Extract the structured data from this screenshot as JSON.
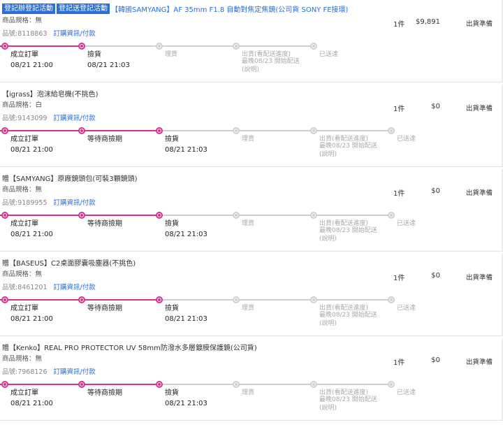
{
  "colors": {
    "accent": "#d9308c",
    "inactive": "#cfcfcf",
    "link": "#2a6fd6"
  },
  "orders": [
    {
      "badges": [
        "登記辦登記活動",
        "登記送登記活動"
      ],
      "name": "【韓國SAMYANG】AF 35mm F1.8 自動對焦定焦鏡(公司貨 SONY FE接環)",
      "name_color": "blue",
      "spec": "商品規格：無",
      "sku": "品號:8118863",
      "link": "訂購資訊/付款",
      "qty": "1件",
      "price": "$9,891",
      "status": "出貨準備",
      "steps": [
        {
          "label": "成立訂單",
          "time": "08/21 21:00",
          "active": true
        },
        {
          "label": "撿貨",
          "time": "08/21 21:03",
          "active": true
        },
        {
          "label": "理貨",
          "active": false
        },
        {
          "label": "出貨(看配送進度)",
          "note": "最晚08/23 開始配送\n(說明)",
          "active": false
        },
        {
          "label": "已送達",
          "active": false
        }
      ]
    },
    {
      "badges": [],
      "name": "【igrass】泡沫給皂機(不挑色)",
      "name_color": "dark",
      "spec": "商品規格：白",
      "sku": "品號:9143099",
      "link": "訂購資訊/付款",
      "qty": "1件",
      "price": "$0",
      "status": "出貨準備",
      "steps": [
        {
          "label": "成立訂單",
          "time": "08/21 21:00",
          "active": true
        },
        {
          "label": "等待商撿期",
          "active": true
        },
        {
          "label": "撿貨",
          "time": "08/21 21:03",
          "active": true
        },
        {
          "label": "理貨",
          "active": false
        },
        {
          "label": "出貨(看配送進度)",
          "note": "最晚08/23 開始配送\n(說明)",
          "active": false
        },
        {
          "label": "已送達",
          "active": false
        }
      ]
    },
    {
      "badges": [],
      "name": "贈【SAMYANG】原廠鏡頭包(可裝3顆鏡頭)",
      "name_color": "dark",
      "spec": "商品規格：無",
      "sku": "品號:9189955",
      "link": "訂購資訊/付款",
      "qty": "1件",
      "price": "$0",
      "status": "出貨準備",
      "steps": [
        {
          "label": "成立訂單",
          "time": "08/21 21:00",
          "active": true
        },
        {
          "label": "等待商撿期",
          "active": true
        },
        {
          "label": "撿貨",
          "time": "08/21 21:03",
          "active": true
        },
        {
          "label": "理貨",
          "active": false
        },
        {
          "label": "出貨(看配送進度)",
          "note": "最晚08/23 開始配送\n(說明)",
          "active": false
        },
        {
          "label": "已送達",
          "active": false
        }
      ]
    },
    {
      "badges": [],
      "name": "贈【BASEUS】C2桌面膠囊吸塵器(不挑色)",
      "name_color": "dark",
      "spec": "商品規格：無",
      "sku": "品號:8461201",
      "link": "訂購資訊/付款",
      "qty": "1件",
      "price": "$0",
      "status": "出貨準備",
      "steps": [
        {
          "label": "成立訂單",
          "time": "08/21 21:00",
          "active": true
        },
        {
          "label": "等待商撿期",
          "active": true
        },
        {
          "label": "撿貨",
          "time": "08/21 21:03",
          "active": true
        },
        {
          "label": "理貨",
          "active": false
        },
        {
          "label": "出貨(看配送進度)",
          "note": "最晚08/23 開始配送\n(說明)",
          "active": false
        },
        {
          "label": "已送達",
          "active": false
        }
      ]
    },
    {
      "badges": [],
      "name": "贈【Kenko】REAL PRO PROTECTOR UV 58mm防潑水多層鍍膜保護鏡(公司貨)",
      "name_color": "dark",
      "spec": "商品規格：無",
      "sku": "品號:7968126",
      "link": "訂購資訊/付款",
      "qty": "1件",
      "price": "$0",
      "status": "出貨準備",
      "steps": [
        {
          "label": "成立訂單",
          "time": "08/21 21:00",
          "active": true
        },
        {
          "label": "等待商撿期",
          "active": true
        },
        {
          "label": "撿貨",
          "time": "08/21 21:03",
          "active": true
        },
        {
          "label": "理貨",
          "active": false
        },
        {
          "label": "出貨(看配送進度)",
          "note": "最晚08/23 開始配送\n(說明)",
          "active": false
        },
        {
          "label": "已送達",
          "active": false
        }
      ]
    }
  ]
}
